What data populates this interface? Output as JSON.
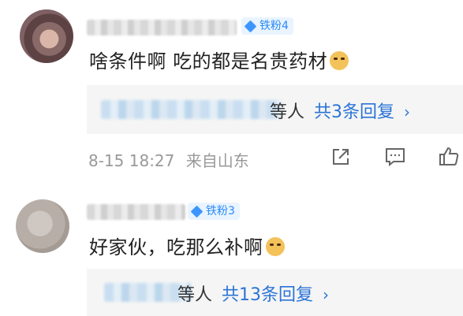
{
  "comments": [
    {
      "badge": "铁粉4",
      "text": "啥条件啊 吃的都是名贵药材",
      "reply": {
        "people": "等人",
        "count": "共3条回复",
        "chevron": "›"
      },
      "time": "8-15 18:27",
      "source": "来自山东"
    },
    {
      "badge": "铁粉3",
      "text": "好家伙，吃那么补啊",
      "reply": {
        "people": "等人",
        "count": "共13条回复",
        "chevron": "›"
      }
    }
  ],
  "icons": [
    "share-icon",
    "comment-icon",
    "like-icon",
    "diamond-icon",
    "doge-emoji"
  ],
  "colors": {
    "link": "#2b74d6",
    "badge_bg": "#e9f4ff",
    "badge_text": "#2b8af7",
    "meta": "#999999",
    "reply_bg": "#f5f5f5"
  }
}
